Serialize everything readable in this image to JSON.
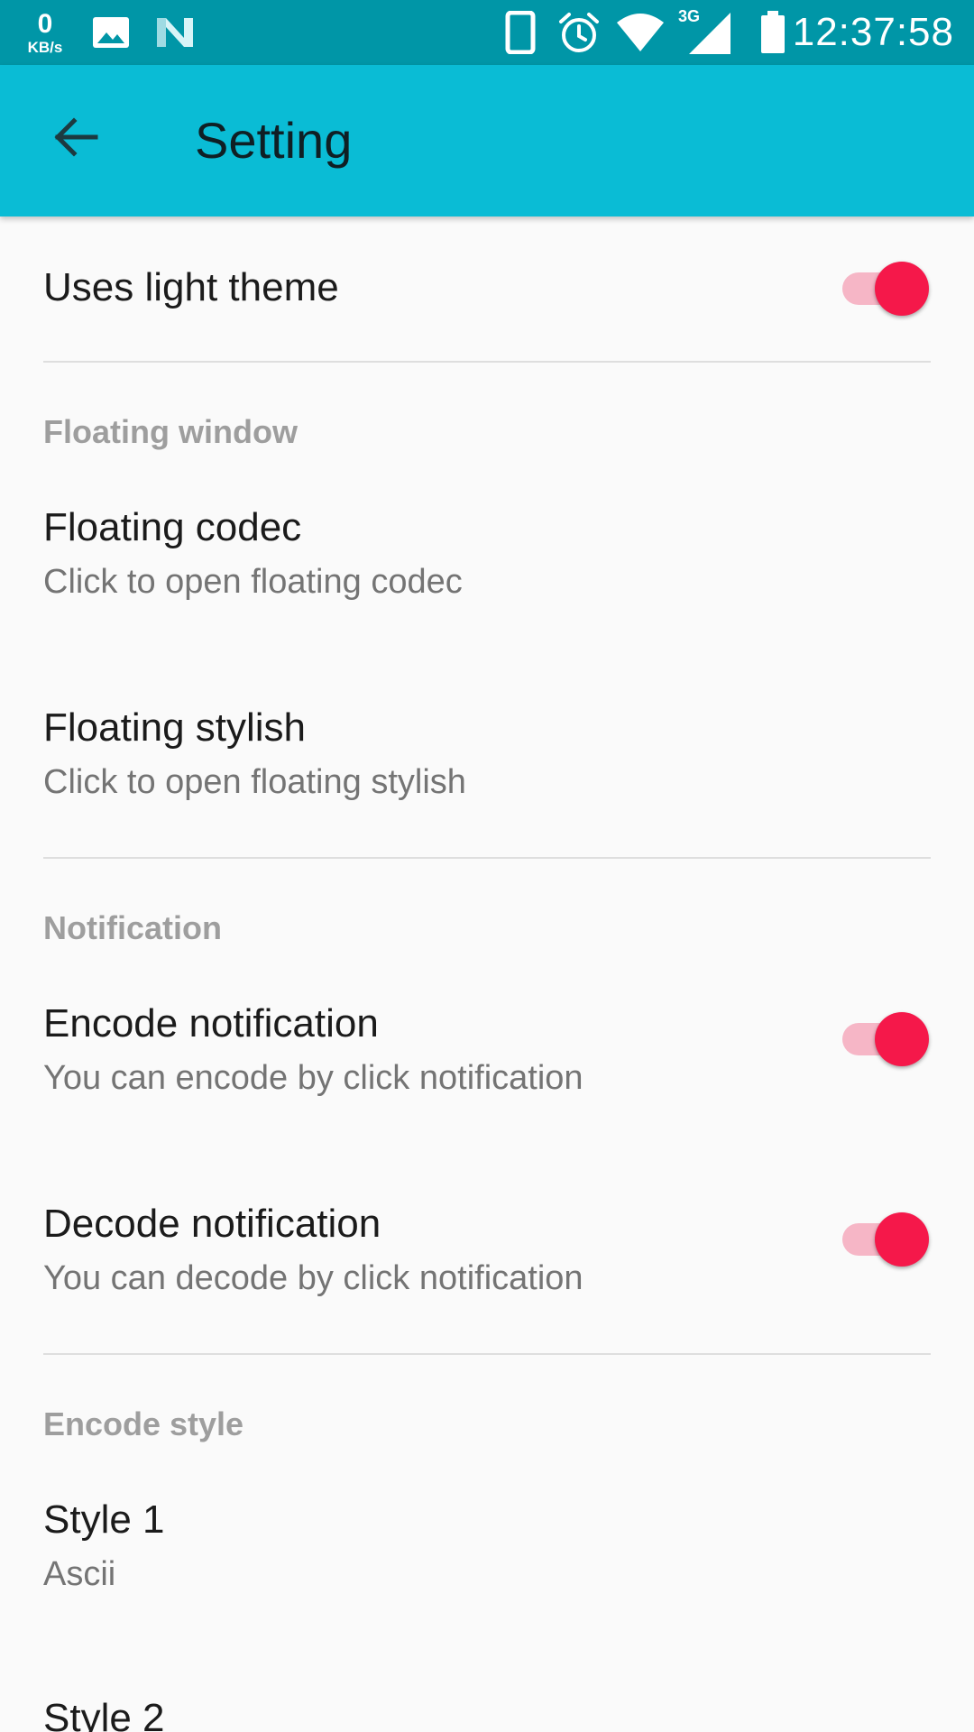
{
  "status_bar": {
    "speed_value": "0",
    "speed_unit": "KB/s",
    "time": "12:37:58",
    "network": "3G",
    "icons": [
      "gallery-icon",
      "n-logo-icon",
      "phone-icon",
      "alarm-icon",
      "wifi-icon",
      "signal-icon",
      "battery-icon"
    ],
    "background_color": "#0096a7"
  },
  "app_bar": {
    "title": "Setting",
    "back_icon": "arrow-left-icon",
    "background_color": "#0abcd5"
  },
  "settings": {
    "light_theme": {
      "title": "Uses light theme",
      "enabled": true
    },
    "floating_window": {
      "category": "Floating window",
      "codec": {
        "title": "Floating codec",
        "summary": "Click to open floating codec"
      },
      "stylish": {
        "title": "Floating stylish",
        "summary": "Click to open floating stylish"
      }
    },
    "notification": {
      "category": "Notification",
      "encode": {
        "title": "Encode notification",
        "summary": "You can encode by click notification",
        "enabled": true
      },
      "decode": {
        "title": "Decode notification",
        "summary": "You can decode by click notification",
        "enabled": true
      }
    },
    "encode_style": {
      "category": "Encode style",
      "style1": {
        "title": "Style 1",
        "summary": "Ascii"
      },
      "style2": {
        "title": "Style 2"
      }
    }
  },
  "colors": {
    "accent": "#f5184a",
    "switch_track": "#f6b6c6"
  }
}
